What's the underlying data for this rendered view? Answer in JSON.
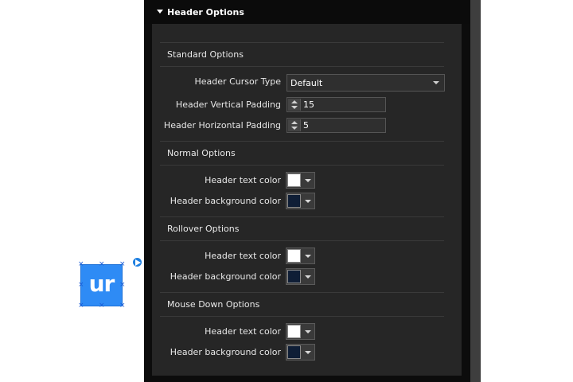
{
  "widget": {
    "label": "ur",
    "color": "#2e8bf5"
  },
  "panel": {
    "title": "Header Options",
    "standard": {
      "title": "Standard Options",
      "cursor_label": "Header Cursor Type",
      "cursor_value": "Default",
      "vpad_label": "Header Vertical Padding",
      "vpad_value": "15",
      "hpad_label": "Header Horizontal Padding",
      "hpad_value": "5"
    },
    "normal": {
      "title": "Normal Options",
      "text_label": "Header text color",
      "text_color": "#ffffff",
      "bg_label": "Header background color",
      "bg_color": "#0f1e36"
    },
    "rollover": {
      "title": "Rollover Options",
      "text_label": "Header text color",
      "text_color": "#ffffff",
      "bg_label": "Header background color",
      "bg_color": "#0f1e36"
    },
    "mousedown": {
      "title": "Mouse Down Options",
      "text_label": "Header text color",
      "text_color": "#ffffff",
      "bg_label": "Header background color",
      "bg_color": "#0f1e36"
    }
  }
}
